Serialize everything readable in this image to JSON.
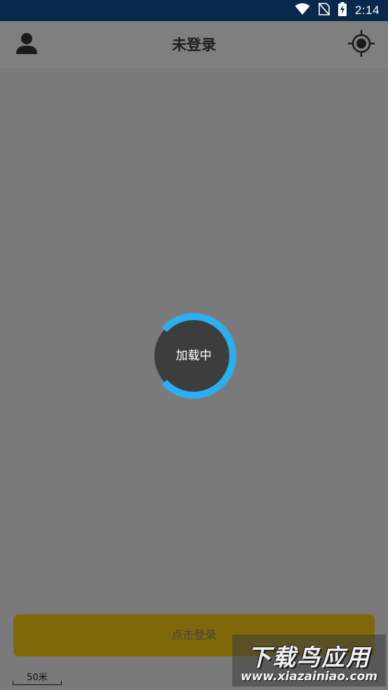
{
  "status_bar": {
    "time": "2:14",
    "icons": [
      "wifi-icon",
      "no-sim-icon",
      "battery-charging-icon"
    ]
  },
  "header": {
    "title": "未登录",
    "left_icon": "user-icon",
    "right_icon": "locate-icon"
  },
  "loader": {
    "text": "加载中",
    "progress_arc_color": "#2ab0f0",
    "center_color": "#3d3d3d"
  },
  "login_button": {
    "label": "点击登录",
    "color": "#7f6808"
  },
  "map": {
    "scale_label": "50米"
  },
  "watermark": {
    "title": "下载鸟应用",
    "url": "www.xiazainiao.com"
  }
}
